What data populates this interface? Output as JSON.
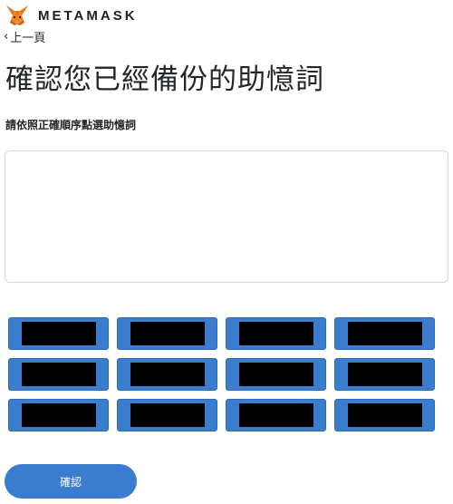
{
  "header": {
    "brand": "METAMASK",
    "logo_icon": "metamask-fox-icon"
  },
  "nav": {
    "back_label": "上一頁"
  },
  "page": {
    "title": "確認您已經備份的助憶詞",
    "instruction": "請依照正確順序點選助憶詞"
  },
  "seed_words": [
    {
      "word": "",
      "redacted": true
    },
    {
      "word": "",
      "redacted": true
    },
    {
      "word": "",
      "redacted": true
    },
    {
      "word": "",
      "redacted": true
    },
    {
      "word": "",
      "redacted": true
    },
    {
      "word": "",
      "redacted": true
    },
    {
      "word": "",
      "redacted": true
    },
    {
      "word": "",
      "redacted": true
    },
    {
      "word": "",
      "redacted": true
    },
    {
      "word": "",
      "redacted": true
    },
    {
      "word": "",
      "redacted": true
    },
    {
      "word": "",
      "redacted": true
    }
  ],
  "actions": {
    "confirm_label": "確認"
  },
  "colors": {
    "accent": "#3a7cce",
    "text": "#24272a",
    "border": "#d6d9dc",
    "redaction": "#000000"
  }
}
